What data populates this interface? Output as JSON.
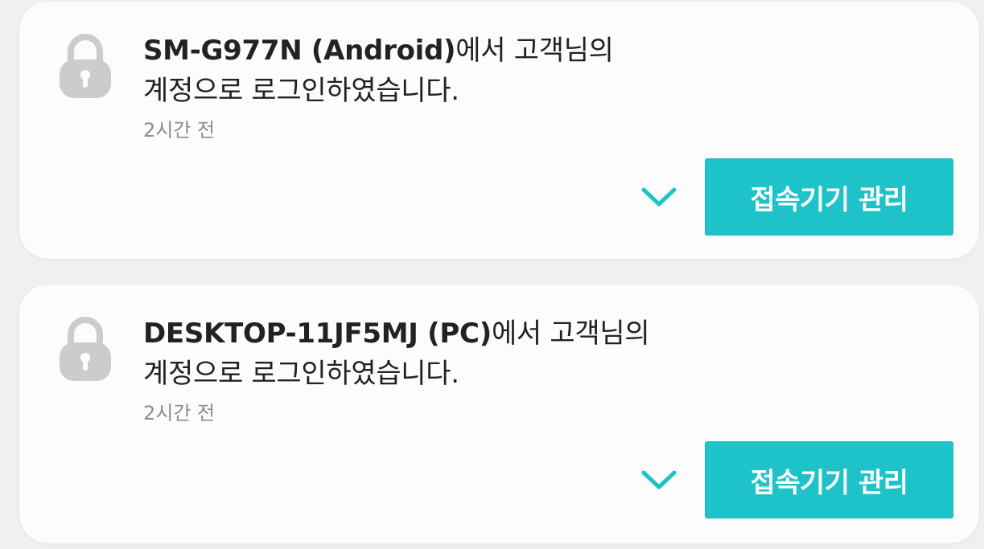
{
  "notifications": [
    {
      "device": "SM-G977N (Android)",
      "message_line1_suffix": "에서 고객님의",
      "message_line2": "계정으로 로그인하였습니다.",
      "time": "2시간 전",
      "expand_icon": "chevron-down-icon",
      "manage_button_label": "접속기기 관리"
    },
    {
      "device": "DESKTOP-11JF5MJ (PC)",
      "message_line1_suffix": "에서 고객님의",
      "message_line2": "계정으로 로그인하였습니다.",
      "time": "2시간 전",
      "expand_icon": "chevron-down-icon",
      "manage_button_label": "접속기기 관리"
    }
  ],
  "colors": {
    "accent": "#1dc3c9",
    "lock_icon": "#cccccc",
    "card_background": "#fcfcfc",
    "page_background": "#f0f0f0",
    "time_text": "#8d8d8d"
  }
}
